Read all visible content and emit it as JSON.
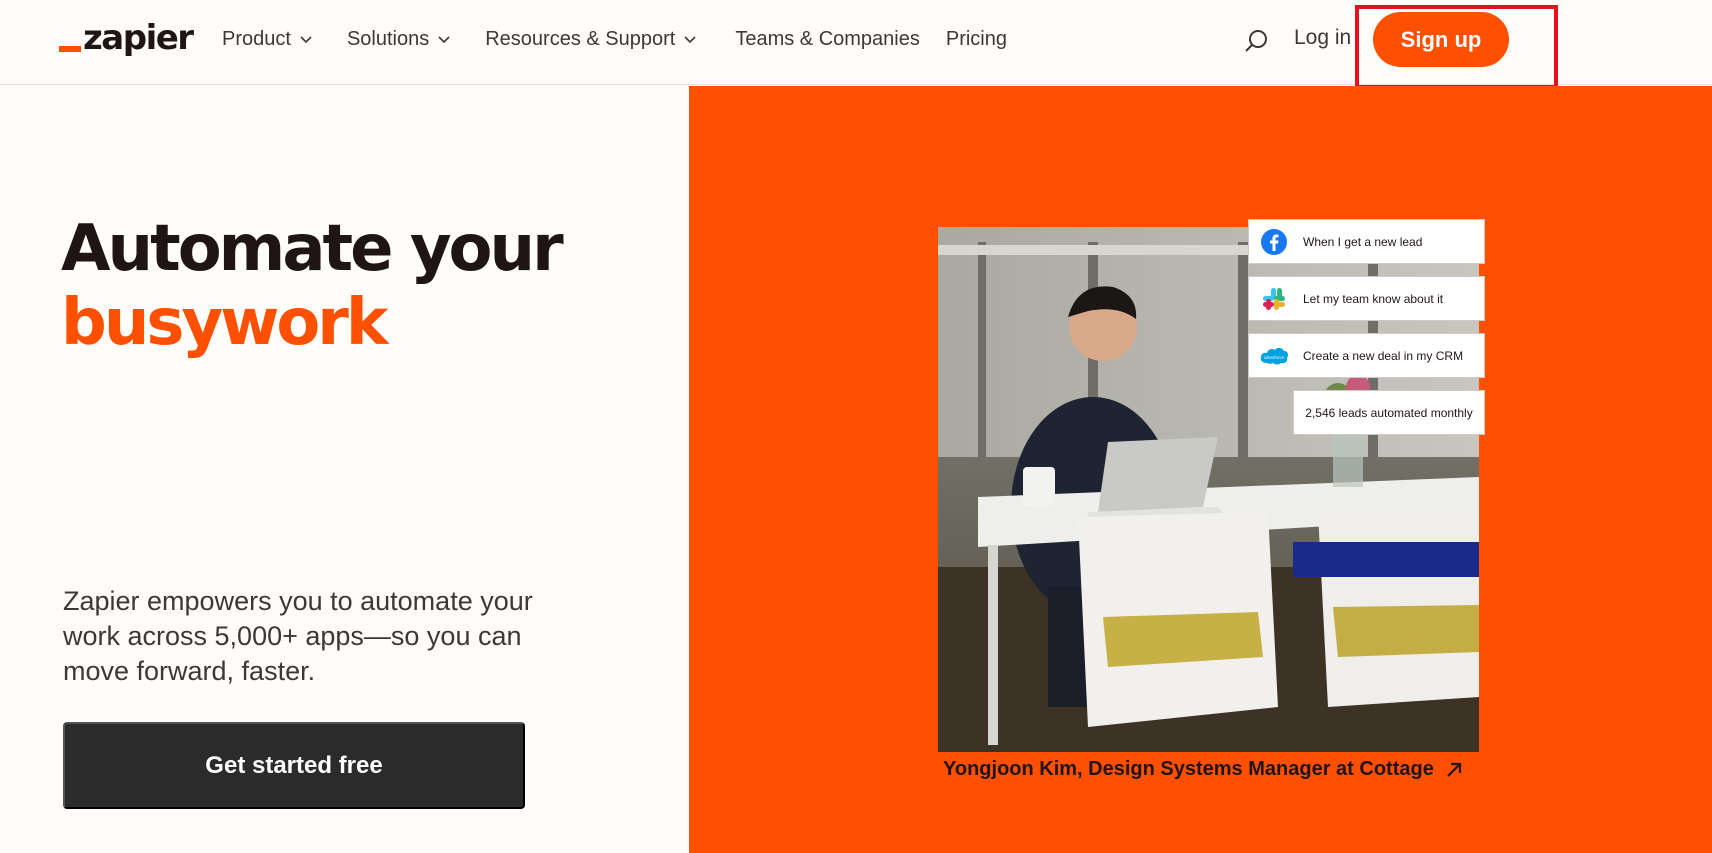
{
  "header": {
    "logo_text": "zapier",
    "nav": [
      {
        "label": "Product",
        "dropdown": true
      },
      {
        "label": "Solutions",
        "dropdown": true
      },
      {
        "label": "Resources & Support",
        "dropdown": true
      },
      {
        "label": "Teams & Companies",
        "dropdown": false
      },
      {
        "label": "Pricing",
        "dropdown": false
      }
    ],
    "login_label": "Log in",
    "signup_label": "Sign up"
  },
  "hero": {
    "title_line1": "Automate your",
    "title_line2": "busywork",
    "description": "Zapier empowers you to automate your work across 5,000+ apps—so you can move forward, faster.",
    "cta_label": "Get started free"
  },
  "workflow": {
    "steps": [
      {
        "icon": "facebook-icon",
        "label": "When I get a new lead"
      },
      {
        "icon": "slack-icon",
        "label": "Let my team know about it"
      },
      {
        "icon": "salesforce-icon",
        "label": "Create a new deal in my CRM"
      }
    ],
    "stat": "2,546 leads automated monthly"
  },
  "caption": "Yongjoon Kim, Design Systems Manager at Cottage",
  "colors": {
    "brand": "#ff4f00",
    "dark": "#201515",
    "highlight": "#e8101d"
  }
}
